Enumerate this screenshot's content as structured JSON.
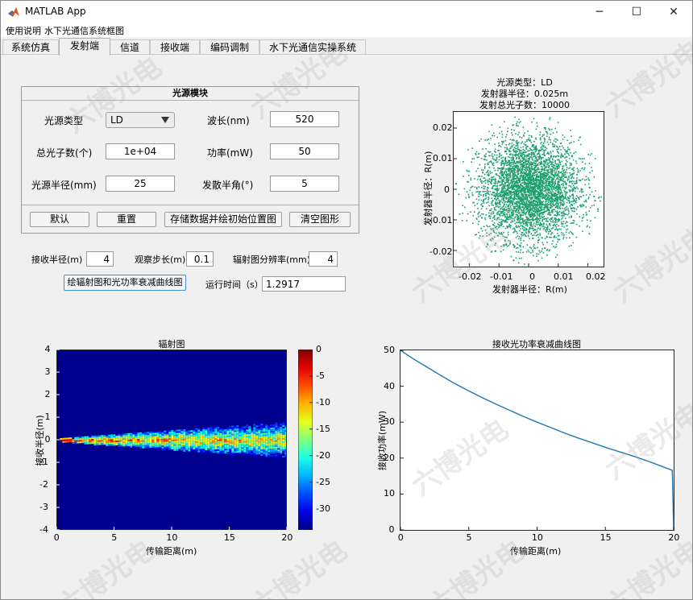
{
  "window": {
    "title": "MATLAB App",
    "min_glyph": "─",
    "max_glyph": "☐",
    "close_glyph": "✕"
  },
  "menu": {
    "items": [
      "使用说明",
      "水下光通信系统框图"
    ]
  },
  "tabs": [
    "系统仿真",
    "发射端",
    "信道",
    "接收端",
    "编码调制",
    "水下光通信实操系统"
  ],
  "active_tab": 1,
  "panel": {
    "title": "光源模块",
    "source_type_label": "光源类型",
    "source_type_value": "LD",
    "wavelength_label": "波长(nm)",
    "wavelength_value": "520",
    "photons_label": "总光子数(个)",
    "photons_value": "1e+04",
    "power_label": "功率(mW)",
    "power_value": "50",
    "radius_label": "光源半径(mm)",
    "radius_value": "25",
    "divergence_label": "发散半角(°)",
    "divergence_value": "5",
    "buttons": {
      "default": "默认",
      "reset": "重置",
      "store": "存储数据并绘初始位置图",
      "clear": "清空图形"
    }
  },
  "params": {
    "recv_radius_label": "接收半径(m)",
    "recv_radius_value": "4",
    "step_label": "观察步长(m)",
    "step_value": "0.1",
    "resolution_label": "辐射图分辨率(mm)",
    "resolution_value": "4",
    "plot_button": "绘辐射图和光功率衰减曲线图",
    "runtime_label": "运行时间（s）",
    "runtime_value": "1.2917"
  },
  "watermark": "六博光电",
  "scatter": {
    "title_lines": [
      "光源类型：LD",
      "发射器半径：0.025m",
      "发射总光子数：10000"
    ],
    "xlabel": "发射器半径：R(m)",
    "ylabel": "发射器半径：R(m)",
    "xticks": [
      "-0.02",
      "-0.01",
      "0",
      "0.01",
      "0.02"
    ],
    "yticks": [
      "0.02",
      "0.01",
      "0",
      "-0.01",
      "-0.02"
    ],
    "color": "#1a9e6e"
  },
  "chart_data": [
    {
      "type": "heatmap",
      "title": "辐射图",
      "xlabel": "传输距离(m)",
      "ylabel": "接收半径(m)",
      "xlim": [
        0,
        20
      ],
      "ylim": [
        -4,
        4
      ],
      "xticks": [
        "0",
        "5",
        "10",
        "15",
        "20"
      ],
      "yticks": [
        "4",
        "3",
        "2",
        "1",
        "0",
        "-1",
        "-2",
        "-3",
        "-4"
      ],
      "colorbar_ticks": [
        "0",
        "-5",
        "-10",
        "-15",
        "-20",
        "-25",
        "-30"
      ],
      "colorbar_range": [
        -34,
        0
      ],
      "background_color": "#00008f",
      "beam_half_width_end": 0.8
    },
    {
      "type": "line",
      "title": "接收光功率衰减曲线图",
      "xlabel": "传输距离(m)",
      "ylabel": "接收功率(mW)",
      "xlim": [
        0,
        20
      ],
      "ylim": [
        0,
        50
      ],
      "xticks": [
        "0",
        "5",
        "10",
        "15",
        "20"
      ],
      "yticks": [
        "50",
        "40",
        "30",
        "20",
        "10",
        "0"
      ],
      "color": "#1f77b4",
      "x": [
        0,
        1,
        2,
        3,
        4,
        5,
        6,
        7,
        8,
        9,
        10,
        11,
        12,
        13,
        14,
        15,
        16,
        17,
        18,
        19,
        19.9,
        20
      ],
      "y": [
        50,
        47.5,
        45.2,
        42.9,
        40.7,
        38.7,
        36.8,
        35.0,
        33.3,
        31.6,
        30.0,
        28.5,
        27.0,
        25.6,
        24.3,
        23.0,
        21.8,
        20.6,
        19.3,
        17.9,
        16.6,
        0
      ]
    }
  ]
}
